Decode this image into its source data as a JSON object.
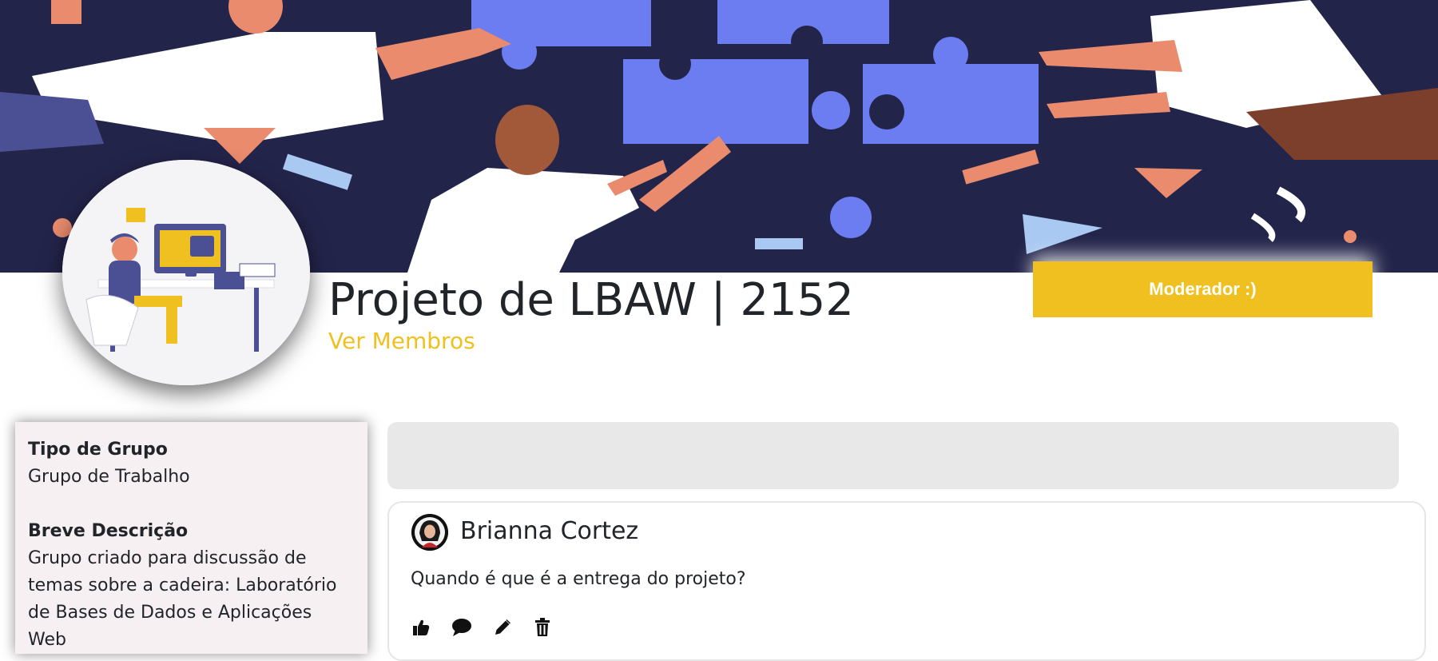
{
  "group": {
    "title": "Projeto de LBAW | 2152",
    "members_link": "Ver Membros",
    "moderator_button": "Moderador :)"
  },
  "sidebar": {
    "type_label": "Tipo de Grupo",
    "type_value": "Grupo de Trabalho",
    "description_label": "Breve Descrição",
    "description_value": "Grupo criado para discussão de temas sobre a cadeira: Laboratório de Bases de Dados e Aplicações Web"
  },
  "post": {
    "author": "Brianna Cortez",
    "text": "Quando é que é a entrega do projeto?",
    "actions": [
      "thumbs-up-icon",
      "comment-icon",
      "pencil-icon",
      "trash-icon"
    ]
  },
  "colors": {
    "accent": "#f0c020",
    "banner_bg": "#23244a",
    "puzzle": "#6b7df0",
    "card_bg": "#f6f0f3",
    "composer_bg": "#e8e8e8"
  }
}
